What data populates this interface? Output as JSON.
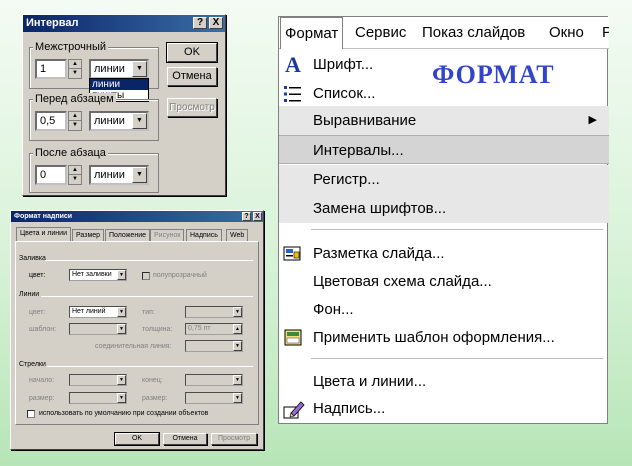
{
  "interval_dialog": {
    "title": "Интервал",
    "title_help": "?",
    "title_close": "X",
    "line_spacing": {
      "label": "Межстрочный",
      "value": "1",
      "unit": "линии"
    },
    "unit_dropdown": [
      "линии",
      "пункты"
    ],
    "before_paragraph": {
      "label": "Перед абзацем",
      "value": "0,5",
      "unit": "линии"
    },
    "after_paragraph": {
      "label": "После абзаца",
      "value": "0",
      "unit": "линии"
    },
    "ok": "OK",
    "cancel": "Отмена",
    "preview": "Просмотр"
  },
  "textbox_dialog": {
    "title": "Формат надписи",
    "title_help": "?",
    "title_close": "X",
    "tabs": [
      "Цвета и линии",
      "Размер",
      "Положение",
      "Рисунок",
      "Надпись",
      "Web"
    ],
    "fill": {
      "section": "Заливка",
      "color_label": "цвет:",
      "color_value": "Нет заливки",
      "translucent": "полупрозрачный"
    },
    "lines": {
      "section": "Линии",
      "color_label": "цвет:",
      "color_value": "Нет линий",
      "type_label": "тип:",
      "pattern_label": "шаблон:",
      "weight_label": "толщина:",
      "weight_value": "0,75 пт",
      "connector_label": "соединительная линия:"
    },
    "arrows": {
      "section": "Стрелки",
      "begin_label": "начало:",
      "end_label": "конец:",
      "size1_label": "размер:",
      "size2_label": "размер:"
    },
    "default_check": "использовать по умолчанию при создании объектов",
    "ok": "OK",
    "cancel": "Отмена",
    "preview": "Просмотр"
  },
  "menubar": {
    "items": [
      "Формат",
      "Сервис",
      "Показ слайдов",
      "Окно",
      "Р"
    ]
  },
  "format_menu": {
    "heading": "ФОРМАТ",
    "items": [
      {
        "label": "Шрифт...",
        "icon": "font-a-icon"
      },
      {
        "label": "Список...",
        "icon": "list-icon"
      },
      {
        "label": "Выравнивание",
        "submenu": true
      },
      {
        "label": "Интервалы..."
      },
      {
        "label": "Регистр..."
      },
      {
        "label": "Замена шрифтов..."
      },
      {
        "label": "Разметка слайда...",
        "icon": "slide-layout-icon"
      },
      {
        "label": "Цветовая схема слайда..."
      },
      {
        "label": "Фон..."
      },
      {
        "label": "Применить шаблон оформления...",
        "icon": "design-template-icon"
      },
      {
        "label": "Цвета и линии..."
      },
      {
        "label": "Надпись...",
        "icon": "textbox-icon"
      }
    ]
  },
  "colors": {
    "title_bar": "#0a246a",
    "heading": "#3344cc",
    "background": "#d8f2d8"
  }
}
